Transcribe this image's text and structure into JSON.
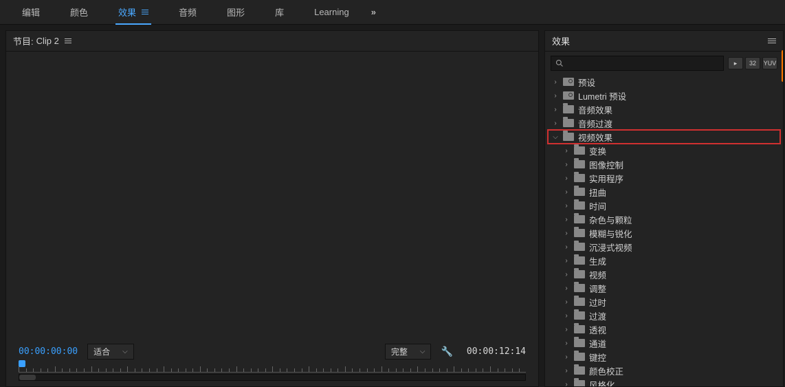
{
  "topbar": {
    "tabs": [
      "编辑",
      "颜色",
      "效果",
      "音频",
      "图形",
      "库",
      "Learning"
    ],
    "active_index": 2,
    "expand_glyph": "»"
  },
  "program_panel": {
    "title_prefix": "节目:",
    "clip_name": "Clip 2",
    "current_tc": "00:00:00:00",
    "duration_tc": "00:00:12:14",
    "fit_label": "适合",
    "quality_label": "完整"
  },
  "effects_panel": {
    "title": "效果",
    "search_placeholder": "",
    "chips": [
      "▸",
      "32",
      "YUV"
    ],
    "tree": [
      {
        "label": "预设",
        "depth": 0,
        "expanded": false,
        "icon": "preset"
      },
      {
        "label": "Lumetri 预设",
        "depth": 0,
        "expanded": false,
        "icon": "preset"
      },
      {
        "label": "音频效果",
        "depth": 0,
        "expanded": false,
        "icon": "folder"
      },
      {
        "label": "音频过渡",
        "depth": 0,
        "expanded": false,
        "icon": "folder"
      },
      {
        "label": "视频效果",
        "depth": 0,
        "expanded": true,
        "icon": "folder",
        "highlighted": true
      },
      {
        "label": "变换",
        "depth": 1,
        "expanded": false,
        "icon": "folder"
      },
      {
        "label": "图像控制",
        "depth": 1,
        "expanded": false,
        "icon": "folder"
      },
      {
        "label": "实用程序",
        "depth": 1,
        "expanded": false,
        "icon": "folder"
      },
      {
        "label": "扭曲",
        "depth": 1,
        "expanded": false,
        "icon": "folder"
      },
      {
        "label": "时间",
        "depth": 1,
        "expanded": false,
        "icon": "folder"
      },
      {
        "label": "杂色与颗粒",
        "depth": 1,
        "expanded": false,
        "icon": "folder"
      },
      {
        "label": "模糊与锐化",
        "depth": 1,
        "expanded": false,
        "icon": "folder"
      },
      {
        "label": "沉浸式视频",
        "depth": 1,
        "expanded": false,
        "icon": "folder"
      },
      {
        "label": "生成",
        "depth": 1,
        "expanded": false,
        "icon": "folder"
      },
      {
        "label": "视频",
        "depth": 1,
        "expanded": false,
        "icon": "folder"
      },
      {
        "label": "调整",
        "depth": 1,
        "expanded": false,
        "icon": "folder"
      },
      {
        "label": "过时",
        "depth": 1,
        "expanded": false,
        "icon": "folder"
      },
      {
        "label": "过渡",
        "depth": 1,
        "expanded": false,
        "icon": "folder"
      },
      {
        "label": "透视",
        "depth": 1,
        "expanded": false,
        "icon": "folder"
      },
      {
        "label": "通道",
        "depth": 1,
        "expanded": false,
        "icon": "folder"
      },
      {
        "label": "键控",
        "depth": 1,
        "expanded": false,
        "icon": "folder"
      },
      {
        "label": "颜色校正",
        "depth": 1,
        "expanded": false,
        "icon": "folder"
      },
      {
        "label": "风格化",
        "depth": 1,
        "expanded": false,
        "icon": "folder"
      }
    ]
  }
}
